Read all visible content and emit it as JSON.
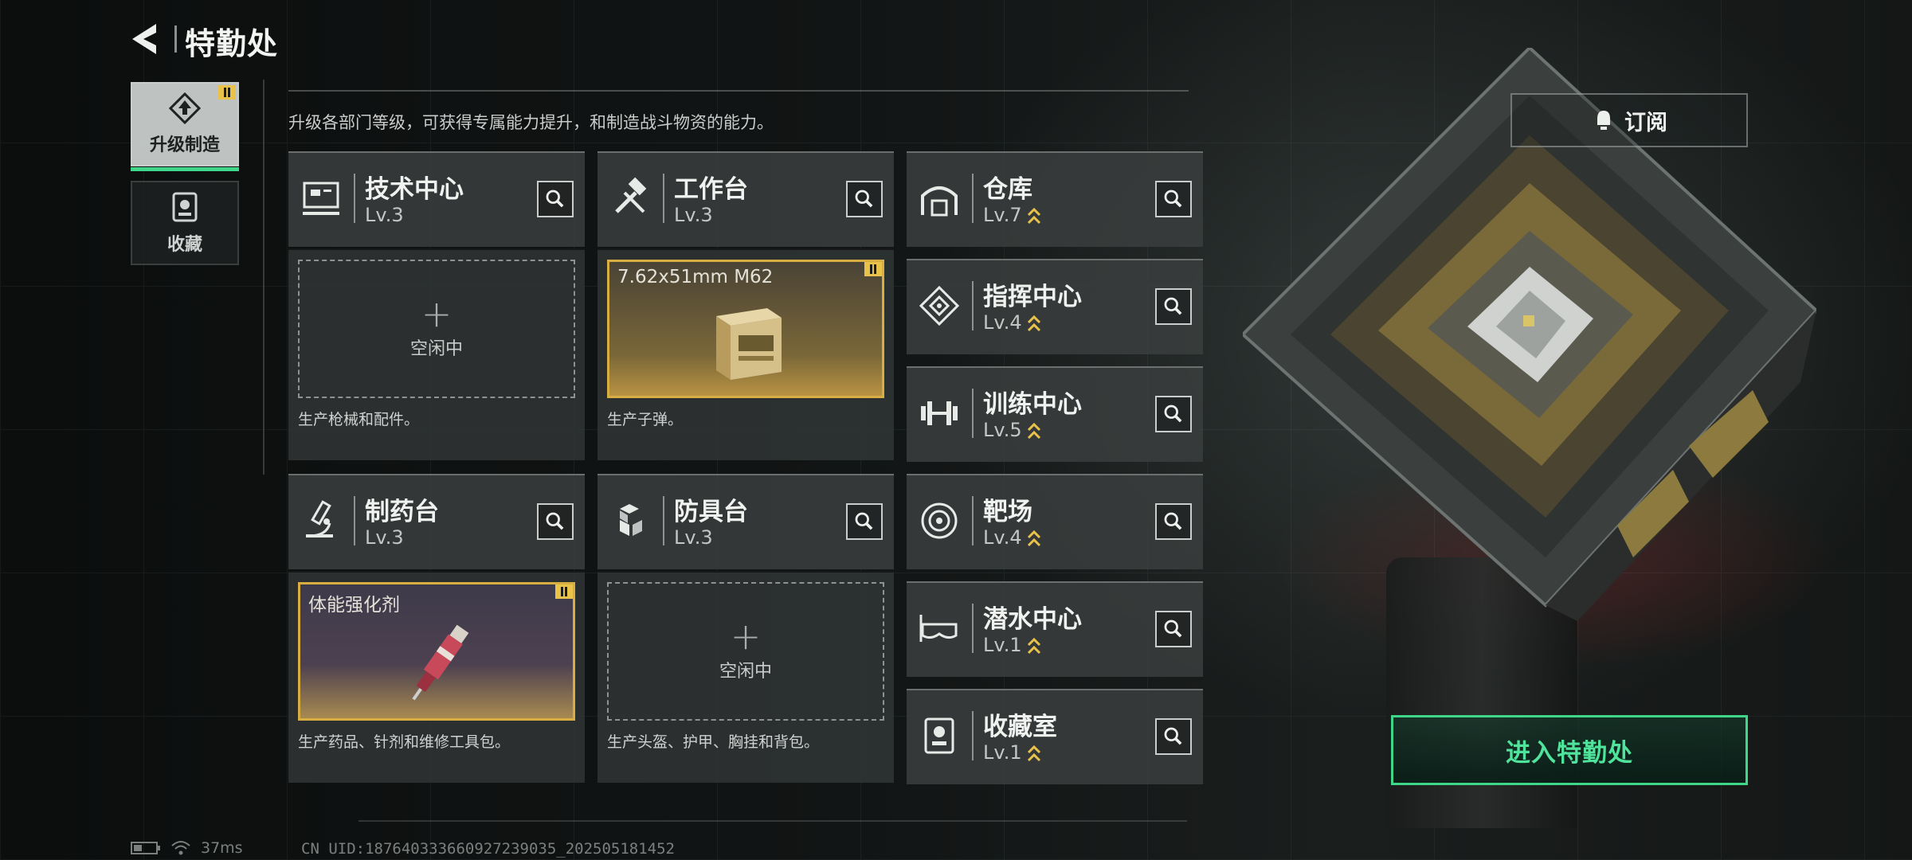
{
  "header": {
    "title": "特勤处"
  },
  "tabs": [
    {
      "label": "升级制造",
      "active": true,
      "badge": true,
      "icon": "upgrade-icon"
    },
    {
      "label": "收藏",
      "active": false,
      "badge": false,
      "icon": "collection-icon"
    }
  ],
  "intro": "升级各部门等级，可获得专属能力提升，和制造战斗物资的能力。",
  "subscribe_label": "订阅",
  "enter_label": "进入特勤处",
  "workshops": [
    {
      "name": "技术中心",
      "level": "Lv.3",
      "icon": "tech-center-icon",
      "slot": {
        "state": "empty",
        "text": "空闲中"
      },
      "desc": "生产枪械和配件。"
    },
    {
      "name": "工作台",
      "level": "Lv.3",
      "icon": "workbench-icon",
      "slot": {
        "state": "item",
        "item_name": "7.62x51mm M62",
        "badge": true
      },
      "desc": "生产子弹。"
    },
    {
      "name": "制药台",
      "level": "Lv.3",
      "icon": "pharmacy-icon",
      "slot": {
        "state": "item",
        "item_name": "体能强化剂",
        "badge": true
      },
      "desc": "生产药品、针剂和维修工具包。"
    },
    {
      "name": "防具台",
      "level": "Lv.3",
      "icon": "armor-bench-icon",
      "slot": {
        "state": "empty",
        "text": "空闲中"
      },
      "desc": "生产头盔、护甲、胸挂和背包。"
    }
  ],
  "facilities": [
    {
      "name": "仓库",
      "level": "Lv.7",
      "icon": "warehouse-icon",
      "upgradable": true
    },
    {
      "name": "指挥中心",
      "level": "Lv.4",
      "icon": "command-center-icon",
      "upgradable": true
    },
    {
      "name": "训练中心",
      "level": "Lv.5",
      "icon": "training-center-icon",
      "upgradable": true
    },
    {
      "name": "靶场",
      "level": "Lv.4",
      "icon": "shooting-range-icon",
      "upgradable": true
    },
    {
      "name": "潜水中心",
      "level": "Lv.1",
      "icon": "diving-center-icon",
      "upgradable": true
    },
    {
      "name": "收藏室",
      "level": "Lv.1",
      "icon": "collection-room-icon",
      "upgradable": true
    }
  ],
  "status": {
    "ping": "37ms",
    "uid": "CN UID:187640333660927239035_202505181452"
  },
  "colors": {
    "accent_green": "#3fd68a",
    "badge_yellow": "#e8c24a",
    "item_border": "#d8ad41"
  }
}
